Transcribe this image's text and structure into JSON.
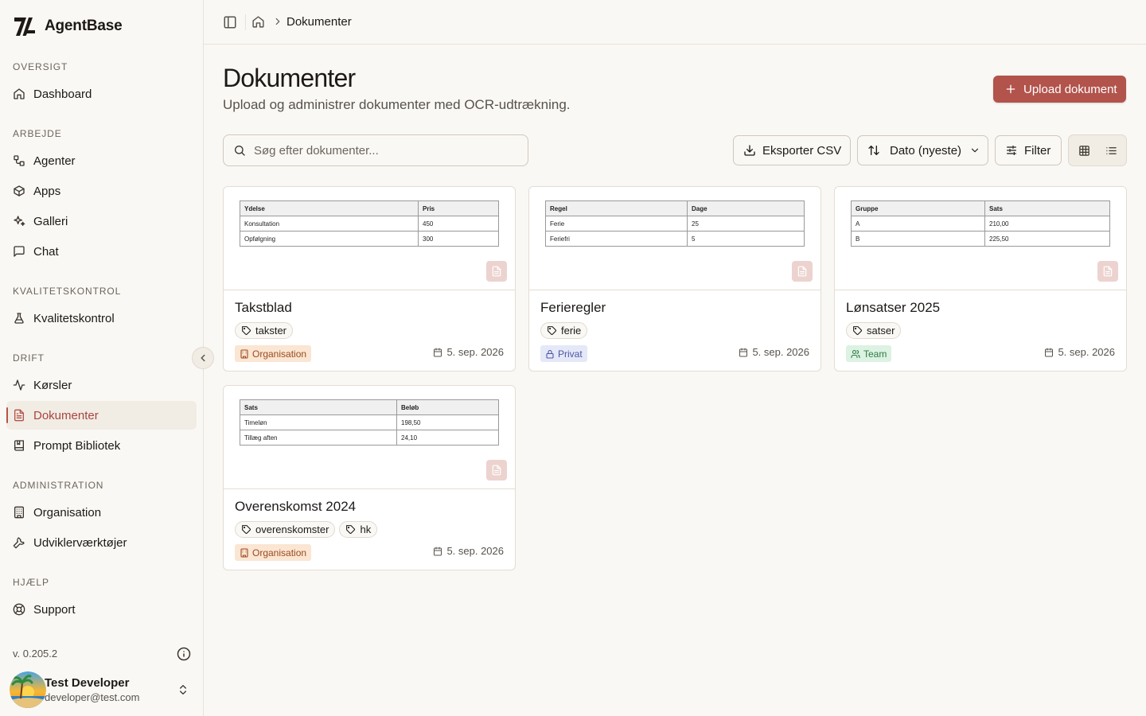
{
  "app": {
    "name": "AgentBase"
  },
  "sidebar": {
    "sections": [
      {
        "label": "OVERSIGT",
        "items": [
          {
            "label": "Dashboard",
            "icon": "home-icon"
          }
        ]
      },
      {
        "label": "ARBEJDE",
        "items": [
          {
            "label": "Agenter",
            "icon": "workflow-icon"
          },
          {
            "label": "Apps",
            "icon": "box-icon"
          },
          {
            "label": "Galleri",
            "icon": "sparkles-icon"
          },
          {
            "label": "Chat",
            "icon": "message-square-icon"
          }
        ]
      },
      {
        "label": "KVALITETSKONTROL",
        "items": [
          {
            "label": "Kvalitetskontrol",
            "icon": "flask-icon"
          }
        ]
      },
      {
        "label": "DRIFT",
        "items": [
          {
            "label": "Kørsler",
            "icon": "activity-icon"
          },
          {
            "label": "Dokumenter",
            "icon": "file-text-icon",
            "active": true
          },
          {
            "label": "Prompt Bibliotek",
            "icon": "book-icon"
          }
        ]
      },
      {
        "label": "ADMINISTRATION",
        "items": [
          {
            "label": "Organisation",
            "icon": "building-icon"
          },
          {
            "label": "Udviklerværktøjer",
            "icon": "wrench-icon"
          }
        ]
      },
      {
        "label": "HJÆLP",
        "items": [
          {
            "label": "Support",
            "icon": "life-buoy-icon"
          }
        ]
      }
    ],
    "version": "v. 0.205.2",
    "user": {
      "name": "Test Developer",
      "email": "developer@test.com"
    }
  },
  "breadcrumb": {
    "current": "Dokumenter"
  },
  "page": {
    "title": "Dokumenter",
    "subtitle": "Upload og administrer dokumenter med OCR-udtrækning.",
    "upload_label": "Upload dokument"
  },
  "toolbar": {
    "search_placeholder": "Søg efter dokumenter...",
    "export_label": "Eksporter CSV",
    "sort_label": "Dato (nyeste)",
    "filter_label": "Filter",
    "view_mode": "grid"
  },
  "colors": {
    "accent": "#b2534c",
    "background": "#faf8f4"
  },
  "documents": [
    {
      "title": "Takstblad",
      "tags": [
        "takster"
      ],
      "visibility": "Organisation",
      "visibility_type": "org",
      "date": "5. sep. 2026",
      "preview": [
        [
          "Ydelse",
          "Pris"
        ],
        [
          "Konsultation",
          "450"
        ],
        [
          "Opfølgning",
          "300"
        ]
      ]
    },
    {
      "title": "Ferieregler",
      "tags": [
        "ferie"
      ],
      "visibility": "Privat",
      "visibility_type": "priv",
      "date": "5. sep. 2026",
      "preview": [
        [
          "Regel",
          "Dage"
        ],
        [
          "Ferie",
          "25"
        ],
        [
          "Feriefri",
          "5"
        ]
      ]
    },
    {
      "title": "Lønsatser 2025",
      "tags": [
        "satser"
      ],
      "visibility": "Team",
      "visibility_type": "team",
      "date": "5. sep. 2026",
      "preview": [
        [
          "Gruppe",
          "Sats"
        ],
        [
          "A",
          "210,00"
        ],
        [
          "B",
          "225,50"
        ]
      ]
    },
    {
      "title": "Overenskomst 2024",
      "tags": [
        "overenskomster",
        "hk"
      ],
      "visibility": "Organisation",
      "visibility_type": "org",
      "date": "5. sep. 2026",
      "preview": [
        [
          "Sats",
          "Beløb"
        ],
        [
          "Timeløn",
          "198,50"
        ],
        [
          "Tillæg aften",
          "24,10"
        ]
      ]
    }
  ]
}
